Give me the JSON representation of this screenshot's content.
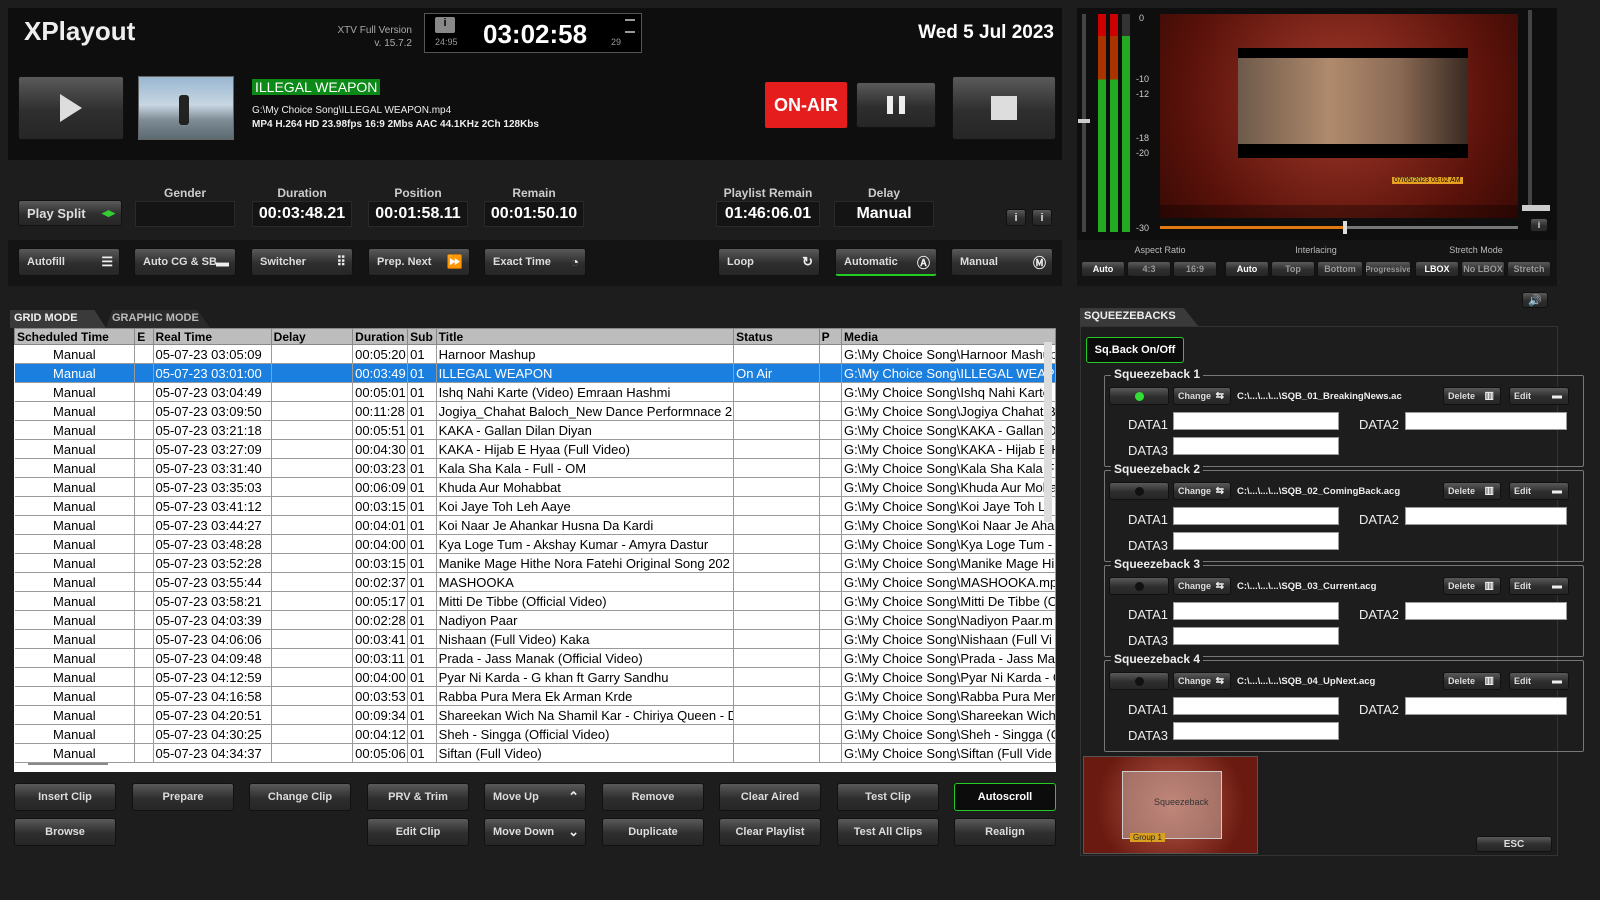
{
  "app": {
    "title": "XPlayout",
    "version_line1": "XTV Full Version",
    "version_line2": "v. 15.7.2",
    "date": "Wed 5 Jul 2023"
  },
  "clock": {
    "time": "03:02:58",
    "left": "24:95",
    "right": "29"
  },
  "now": {
    "title": "ILLEGAL WEAPON",
    "path": "G:\\My Choice Song\\ILLEGAL WEAPON.mp4",
    "info": "MP4 H.264 HD 23.98fps 16:9 2Mbs AAC 44.1KHz 2Ch 128Kbs"
  },
  "buttons": {
    "onair": "ON-AIR",
    "play_split": "Play Split"
  },
  "stats": {
    "gender_label": "Gender",
    "gender": "",
    "duration_label": "Duration",
    "duration": "00:03:48.21",
    "position_label": "Position",
    "position": "00:01:58.11",
    "remain_label": "Remain",
    "remain": "00:01:50.10",
    "playlist_remain_label": "Playlist Remain",
    "playlist_remain": "01:46:06.01",
    "delay_label": "Delay",
    "delay": "Manual"
  },
  "toolbar": {
    "autofill": "Autofill",
    "autocg": "Auto CG & SB",
    "switcher": "Switcher",
    "prepnext": "Prep. Next",
    "exacttime": "Exact Time",
    "loop": "Loop",
    "automatic": "Automatic",
    "manual": "Manual"
  },
  "preview": {
    "stamp": "07/05/2023 03:02 AM",
    "meter_ticks": [
      "0",
      "-10",
      "-12",
      "-18",
      "-20",
      "-30"
    ]
  },
  "modes": {
    "aspect_label": "Aspect Ratio",
    "aspect": [
      "Auto",
      "4:3",
      "16:9"
    ],
    "interlace_label": "Interlacing",
    "interlace": [
      "Auto",
      "Top",
      "Bottom",
      "Progressive"
    ],
    "stretch_label": "Stretch Mode",
    "stretch": [
      "LBOX",
      "No LBOX",
      "Stretch"
    ]
  },
  "tabs": {
    "grid": "GRID MODE",
    "graphic": "GRAPHIC MODE"
  },
  "grid": {
    "headers": [
      "Scheduled Time",
      "E",
      "Real Time",
      "Delay",
      "Duration",
      "Sub",
      "Title",
      "Status",
      "P",
      "Media"
    ],
    "rows": [
      [
        "Manual",
        "",
        "05-07-23  03:05:09",
        "",
        "00:05:20",
        "01",
        "Harnoor Mashup",
        "",
        "",
        "G:\\My Choice Song\\Harnoor Mashup"
      ],
      [
        "Manual",
        "",
        "05-07-23  03:01:00",
        "",
        "00:03:49",
        "01",
        "ILLEGAL WEAPON",
        "On Air",
        "",
        "G:\\My Choice Song\\ILLEGAL WEAP"
      ],
      [
        "Manual",
        "",
        "05-07-23  03:04:49",
        "",
        "00:05:01",
        "01",
        "Ishq Nahi Karte (Video) Emraan Hashmi",
        "",
        "",
        "G:\\My Choice Song\\Ishq Nahi Karte"
      ],
      [
        "Manual",
        "",
        "05-07-23  03:09:50",
        "",
        "00:11:28",
        "01",
        "Jogiya_Chahat Baloch_New Dance Performnace 2",
        "",
        "",
        "G:\\My Choice Song\\Jogiya Chahat B"
      ],
      [
        "Manual",
        "",
        "05-07-23  03:21:18",
        "",
        "00:05:51",
        "01",
        "KAKA - Gallan Dilan Diyan",
        "",
        "",
        "G:\\My Choice Song\\KAKA - Gallan D"
      ],
      [
        "Manual",
        "",
        "05-07-23  03:27:09",
        "",
        "00:04:30",
        "01",
        "KAKA - Hijab E Hyaa (Full Video)",
        "",
        "",
        "G:\\My Choice Song\\KAKA - Hijab E H"
      ],
      [
        "Manual",
        "",
        "05-07-23  03:31:40",
        "",
        "00:03:23",
        "01",
        "Kala Sha Kala - Full - OM",
        "",
        "",
        "G:\\My Choice Song\\Kala Sha Kala F"
      ],
      [
        "Manual",
        "",
        "05-07-23  03:35:03",
        "",
        "00:06:09",
        "01",
        "Khuda Aur Mohabbat",
        "",
        "",
        "G:\\My Choice Song\\Khuda Aur Moha"
      ],
      [
        "Manual",
        "",
        "05-07-23  03:41:12",
        "",
        "00:03:15",
        "01",
        "Koi Jaye Toh Leh Aaye",
        "",
        "",
        "G:\\My Choice Song\\Koi Jaye Toh Le"
      ],
      [
        "Manual",
        "",
        "05-07-23  03:44:27",
        "",
        "00:04:01",
        "01",
        "Koi Naar Je Ahankar Husna Da Kardi",
        "",
        "",
        "G:\\My Choice Song\\Koi Naar Je Aha"
      ],
      [
        "Manual",
        "",
        "05-07-23  03:48:28",
        "",
        "00:04:00",
        "01",
        "Kya Loge Tum - Akshay Kumar - Amyra Dastur",
        "",
        "",
        "G:\\My Choice Song\\Kya Loge Tum -"
      ],
      [
        "Manual",
        "",
        "05-07-23  03:52:28",
        "",
        "00:03:15",
        "01",
        "Manike Mage Hithe Nora Fatehi Original Song 202",
        "",
        "",
        "G:\\My Choice Song\\Manike Mage Hi"
      ],
      [
        "Manual",
        "",
        "05-07-23  03:55:44",
        "",
        "00:02:37",
        "01",
        "MASHOOKA",
        "",
        "",
        "G:\\My Choice Song\\MASHOOKA.mp"
      ],
      [
        "Manual",
        "",
        "05-07-23  03:58:21",
        "",
        "00:05:17",
        "01",
        "Mitti De Tibbe (Official Video)",
        "",
        "",
        "G:\\My Choice Song\\Mitti De Tibbe (C"
      ],
      [
        "Manual",
        "",
        "05-07-23  04:03:39",
        "",
        "00:02:28",
        "01",
        "Nadiyon Paar",
        "",
        "",
        "G:\\My Choice Song\\Nadiyon Paar.m"
      ],
      [
        "Manual",
        "",
        "05-07-23  04:06:06",
        "",
        "00:03:41",
        "01",
        "Nishaan (Full Video) Kaka",
        "",
        "",
        "G:\\My Choice Song\\Nishaan (Full Vi"
      ],
      [
        "Manual",
        "",
        "05-07-23  04:09:48",
        "",
        "00:03:11",
        "01",
        "Prada - Jass Manak (Official Video)",
        "",
        "",
        "G:\\My Choice Song\\Prada - Jass Ma"
      ],
      [
        "Manual",
        "",
        "05-07-23  04:12:59",
        "",
        "00:04:00",
        "01",
        "Pyar Ni Karda - G khan ft Garry Sandhu",
        "",
        "",
        "G:\\My Choice Song\\Pyar Ni Karda - G"
      ],
      [
        "Manual",
        "",
        "05-07-23  04:16:58",
        "",
        "00:03:53",
        "01",
        "Rabba Pura Mera Ek Arman Krde",
        "",
        "",
        "G:\\My Choice Song\\Rabba Pura Mer"
      ],
      [
        "Manual",
        "",
        "05-07-23  04:20:51",
        "",
        "00:09:34",
        "01",
        "Shareekan Wich Na Shamil Kar - Chiriya Queen - D",
        "",
        "",
        "G:\\My Choice Song\\Shareekan Wich"
      ],
      [
        "Manual",
        "",
        "05-07-23  04:30:25",
        "",
        "00:04:12",
        "01",
        "Sheh - Singga (Official Video)",
        "",
        "",
        "G:\\My Choice Song\\Sheh - Singga (C"
      ],
      [
        "Manual",
        "",
        "05-07-23  04:34:37",
        "",
        "00:05:06",
        "01",
        "Siftan (Full Video)",
        "",
        "",
        "G:\\My Choice Song\\Siftan (Full Vide"
      ]
    ]
  },
  "actions": {
    "insert": "Insert Clip",
    "prepare": "Prepare",
    "change": "Change Clip",
    "prv": "PRV & Trim",
    "moveup": "Move Up",
    "remove": "Remove",
    "clearaired": "Clear Aired",
    "testclip": "Test Clip",
    "autoscroll": "Autoscroll",
    "browse": "Browse",
    "edit": "Edit Clip",
    "movedown": "Move Down",
    "duplicate": "Duplicate",
    "clearplaylist": "Clear Playlist",
    "testall": "Test All Clips",
    "realign": "Realign"
  },
  "squeeze": {
    "title": "SQUEEZEBACKS",
    "toggle": "Sq.Back On/Off",
    "change": "Change",
    "delete": "Delete",
    "edit": "Edit",
    "data1": "DATA1",
    "data2": "DATA2",
    "data3": "DATA3",
    "items": [
      {
        "name": "Squeezeback 1",
        "file": "C:\\...\\...\\...\\SQB_01_BreakingNews.ac"
      },
      {
        "name": "Squeezeback 2",
        "file": "C:\\...\\...\\...\\SQB_02_ComingBack.acg"
      },
      {
        "name": "Squeezeback 3",
        "file": "C:\\...\\...\\...\\SQB_03_Current.acg"
      },
      {
        "name": "Squeezeback 4",
        "file": "C:\\...\\...\\...\\SQB_04_UpNext.acg"
      }
    ],
    "thumb_label": "Squeezeback",
    "thumb_group": "Group 1",
    "esc": "ESC"
  }
}
